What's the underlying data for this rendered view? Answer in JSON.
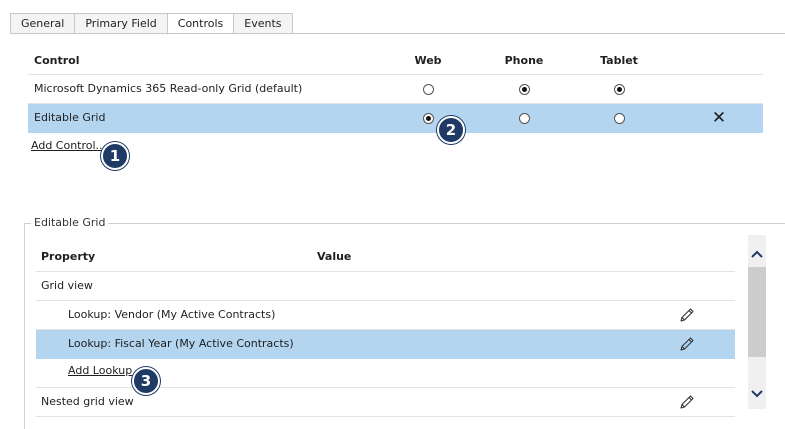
{
  "tabs": [
    {
      "label": "General",
      "active": false
    },
    {
      "label": "Primary Field",
      "active": false
    },
    {
      "label": "Controls",
      "active": true
    },
    {
      "label": "Events",
      "active": false
    }
  ],
  "controls_table": {
    "columns": {
      "control": "Control",
      "web": "Web",
      "phone": "Phone",
      "tablet": "Tablet"
    },
    "rows": [
      {
        "name": "Microsoft Dynamics 365 Read-only Grid (default)",
        "web": false,
        "phone": true,
        "tablet": true,
        "selected": false,
        "removable": false
      },
      {
        "name": "Editable Grid",
        "web": true,
        "phone": false,
        "tablet": false,
        "selected": true,
        "removable": true,
        "remove_symbol": "✕"
      }
    ],
    "add_control_label": "Add Control..."
  },
  "callouts": [
    "1",
    "2",
    "3"
  ],
  "editable_grid": {
    "group_label": "Editable Grid",
    "columns": {
      "property": "Property",
      "value": "Value"
    },
    "rows": [
      {
        "property": "Grid view",
        "indent": false,
        "editable": false,
        "selected": false
      },
      {
        "property": "Lookup: Vendor (My Active Contracts)",
        "indent": true,
        "editable": true,
        "selected": false
      },
      {
        "property": "Lookup: Fiscal Year (My Active Contracts)",
        "indent": true,
        "editable": true,
        "selected": true
      },
      {
        "property": "Add Lookup",
        "indent": true,
        "editable": false,
        "selected": false,
        "link": true
      },
      {
        "property": "Nested grid view",
        "indent": false,
        "editable": true,
        "selected": false
      }
    ]
  },
  "colors": {
    "selected_row": "#b3d5f0",
    "callout": "#1f3a64"
  },
  "icons": {
    "edit": "pencil-icon",
    "remove": "close-icon",
    "scroll_up": "chevron-up-icon",
    "scroll_down": "chevron-down-icon"
  }
}
